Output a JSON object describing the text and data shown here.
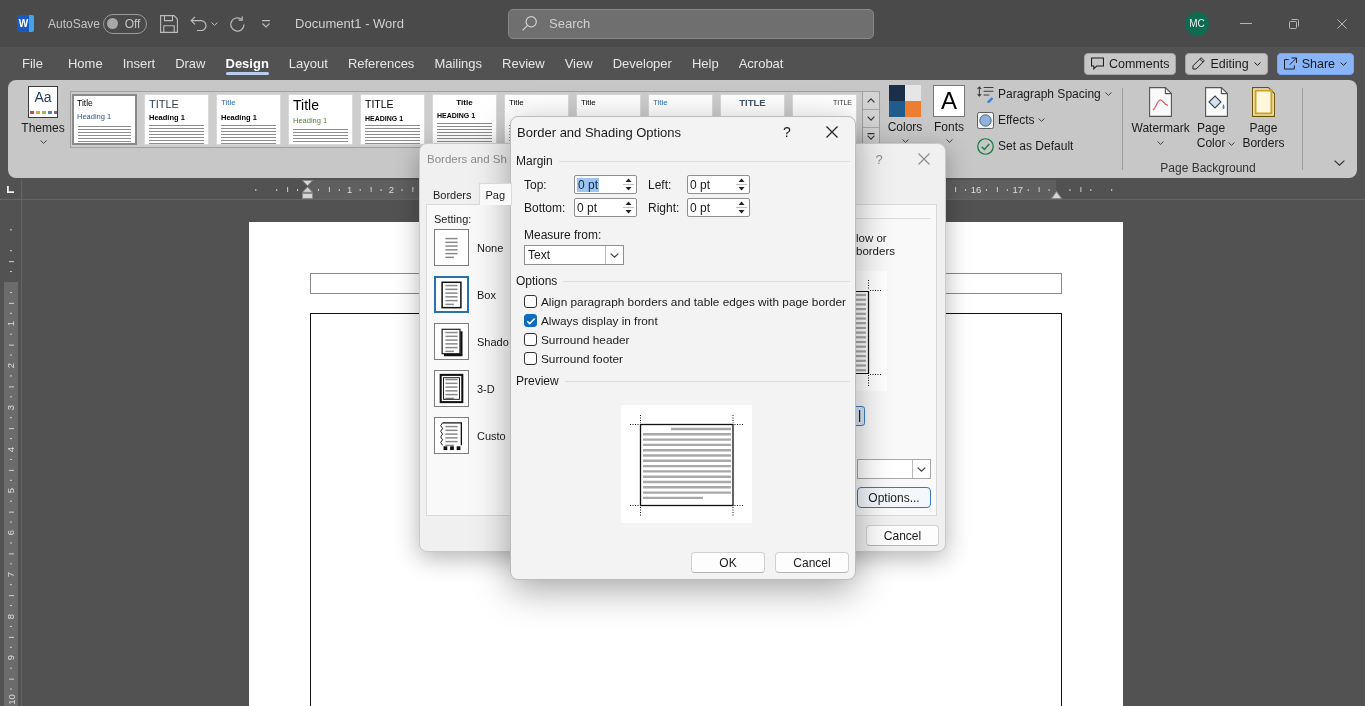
{
  "title_bar": {
    "app_logo": "W",
    "autosave_label": "AutoSave",
    "autosave_toggle": {
      "label": "Off",
      "on": false
    },
    "document_title": "Document1 - Word",
    "search": {
      "placeholder": "Search"
    },
    "account_initials": "MC"
  },
  "menu_tabs": [
    {
      "label": "File",
      "selected": false
    },
    {
      "label": "Home",
      "selected": false
    },
    {
      "label": "Insert",
      "selected": false
    },
    {
      "label": "Draw",
      "selected": false
    },
    {
      "label": "Design",
      "selected": true
    },
    {
      "label": "Layout",
      "selected": false
    },
    {
      "label": "References",
      "selected": false
    },
    {
      "label": "Mailings",
      "selected": false
    },
    {
      "label": "Review",
      "selected": false
    },
    {
      "label": "View",
      "selected": false
    },
    {
      "label": "Developer",
      "selected": false
    },
    {
      "label": "Help",
      "selected": false
    },
    {
      "label": "Acrobat",
      "selected": false
    }
  ],
  "header_buttons": [
    {
      "label": "Comments",
      "kind": "comments"
    },
    {
      "label": "Editing",
      "kind": "editing"
    },
    {
      "label": "Share",
      "kind": "share"
    }
  ],
  "ribbon": {
    "themes": {
      "label": "Themes",
      "sample": "Aa"
    },
    "style_gallery": [
      {
        "title": "Title",
        "heading": "Heading 1",
        "kind": "plain",
        "selected": true
      },
      {
        "title": "TITLE",
        "heading": "Heading 1",
        "kind": "caps",
        "selected": false
      },
      {
        "title": "Title",
        "heading": "Heading 1",
        "kind": "accent",
        "selected": false
      },
      {
        "title": "Title",
        "heading": "Heading 1",
        "kind": "large",
        "selected": false
      },
      {
        "title": "TITLE",
        "heading": "HEADING 1",
        "kind": "upper",
        "selected": false
      },
      {
        "title": "Title",
        "heading": "HEADING 1",
        "kind": "centered",
        "selected": false
      },
      {
        "title": "Title",
        "kind": "simple",
        "selected": false
      },
      {
        "title": "Title",
        "kind": "simple",
        "selected": false
      },
      {
        "title": "Title",
        "kind": "accent",
        "selected": false
      },
      {
        "title": "TITLE",
        "kind": "banner",
        "selected": false
      },
      {
        "title": "TITLE",
        "kind": "right",
        "selected": false
      }
    ],
    "colors": {
      "label": "Colors"
    },
    "fonts": {
      "label": "Fonts",
      "sample": "A"
    },
    "formatting_options": [
      {
        "label": "Paragraph Spacing",
        "kind": "paragraph-spacing",
        "dropdown": true
      },
      {
        "label": "Effects",
        "kind": "effects",
        "dropdown": true
      },
      {
        "label": "Set as Default",
        "kind": "set-default",
        "dropdown": false
      }
    ],
    "page_background": {
      "label": "Page Background",
      "buttons": [
        {
          "label": "Watermark",
          "kind": "watermark",
          "dropdown": true
        },
        {
          "label": "Page Color",
          "kind": "page-color",
          "dropdown": true
        },
        {
          "label": "Page Borders",
          "kind": "page-borders",
          "dropdown": false
        }
      ]
    }
  },
  "horizontal_ruler": {
    "left_numbers": [
      "1",
      "2"
    ],
    "right_numbers": [
      "16",
      "17"
    ]
  },
  "vertical_ruler": {
    "numbers": [
      "1",
      "2",
      "3",
      "4",
      "5",
      "6",
      "7",
      "8",
      "9",
      "10"
    ]
  },
  "borders_dialog": {
    "title": "Borders and Sh",
    "help": "?",
    "tabs": [
      {
        "label": "Borders",
        "selected": false
      },
      {
        "label": "Pag",
        "selected": true
      }
    ],
    "setting_label": "Setting:",
    "settings": [
      {
        "label": "None",
        "kind": "none",
        "selected": false
      },
      {
        "label": "Box",
        "kind": "box",
        "selected": true
      },
      {
        "label": "Shado",
        "kind": "shadow",
        "selected": false
      },
      {
        "label": "3-D",
        "kind": "double",
        "selected": false
      },
      {
        "label": "Custo",
        "kind": "custom",
        "selected": false
      }
    ],
    "hint": "low or borders",
    "options_button": {
      "label": "Options...",
      "focused": true
    },
    "cancel_button": {
      "label": "Cancel",
      "focused": false
    }
  },
  "options_dialog": {
    "title": "Border and Shading Options",
    "help": "?",
    "margin_heading": "Margin",
    "margins": [
      {
        "label": "Top:",
        "value": "0 pt",
        "focused": true
      },
      {
        "label": "Left:",
        "value": "0 pt",
        "focused": false
      },
      {
        "label": "Bottom:",
        "value": "0 pt",
        "focused": false
      },
      {
        "label": "Right:",
        "value": "0 pt",
        "focused": false
      }
    ],
    "measure_from": {
      "label": "Measure from:",
      "value": "Text"
    },
    "options_heading": "Options",
    "options": [
      {
        "label": "Align paragraph borders and table edges with page border",
        "checked": false
      },
      {
        "label": "Always display in front",
        "checked": true
      },
      {
        "label": "Surround header",
        "checked": false
      },
      {
        "label": "Surround footer",
        "checked": false
      }
    ],
    "preview_heading": "Preview",
    "buttons": [
      "OK",
      "Cancel"
    ]
  }
}
